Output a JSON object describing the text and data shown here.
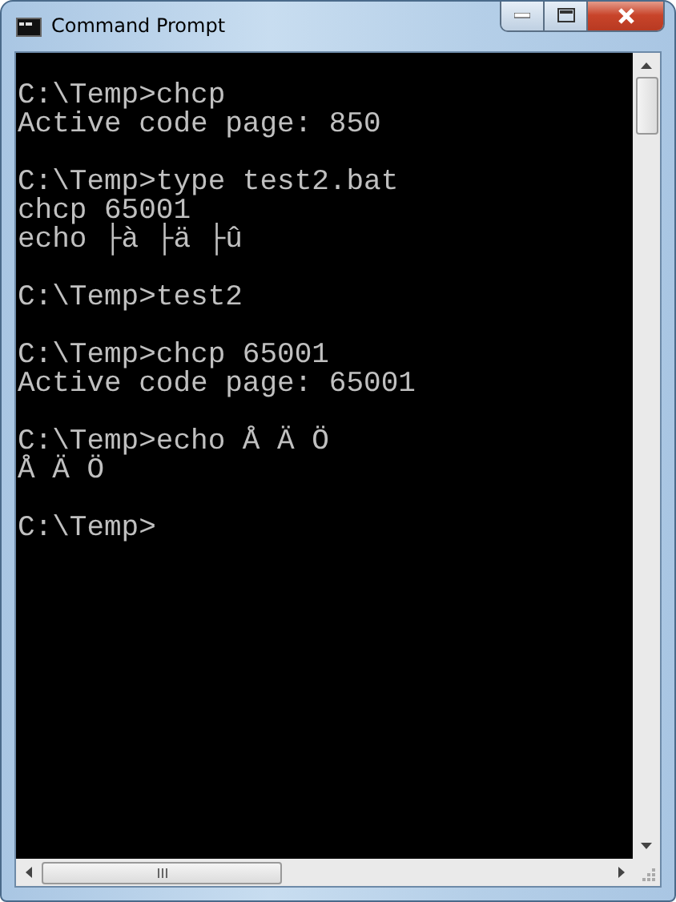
{
  "window": {
    "title": "Command Prompt"
  },
  "console": {
    "blocks": [
      [
        "C:\\Temp>chcp",
        "Active code page: 850"
      ],
      [
        "C:\\Temp>type test2.bat",
        "chcp 65001",
        "echo ├à ├ä ├û"
      ],
      [
        "C:\\Temp>test2"
      ],
      [
        "C:\\Temp>chcp 65001",
        "Active code page: 65001"
      ],
      [
        "C:\\Temp>echo Å Ä Ö",
        "Å Ä Ö"
      ],
      [
        "C:\\Temp>"
      ]
    ]
  }
}
